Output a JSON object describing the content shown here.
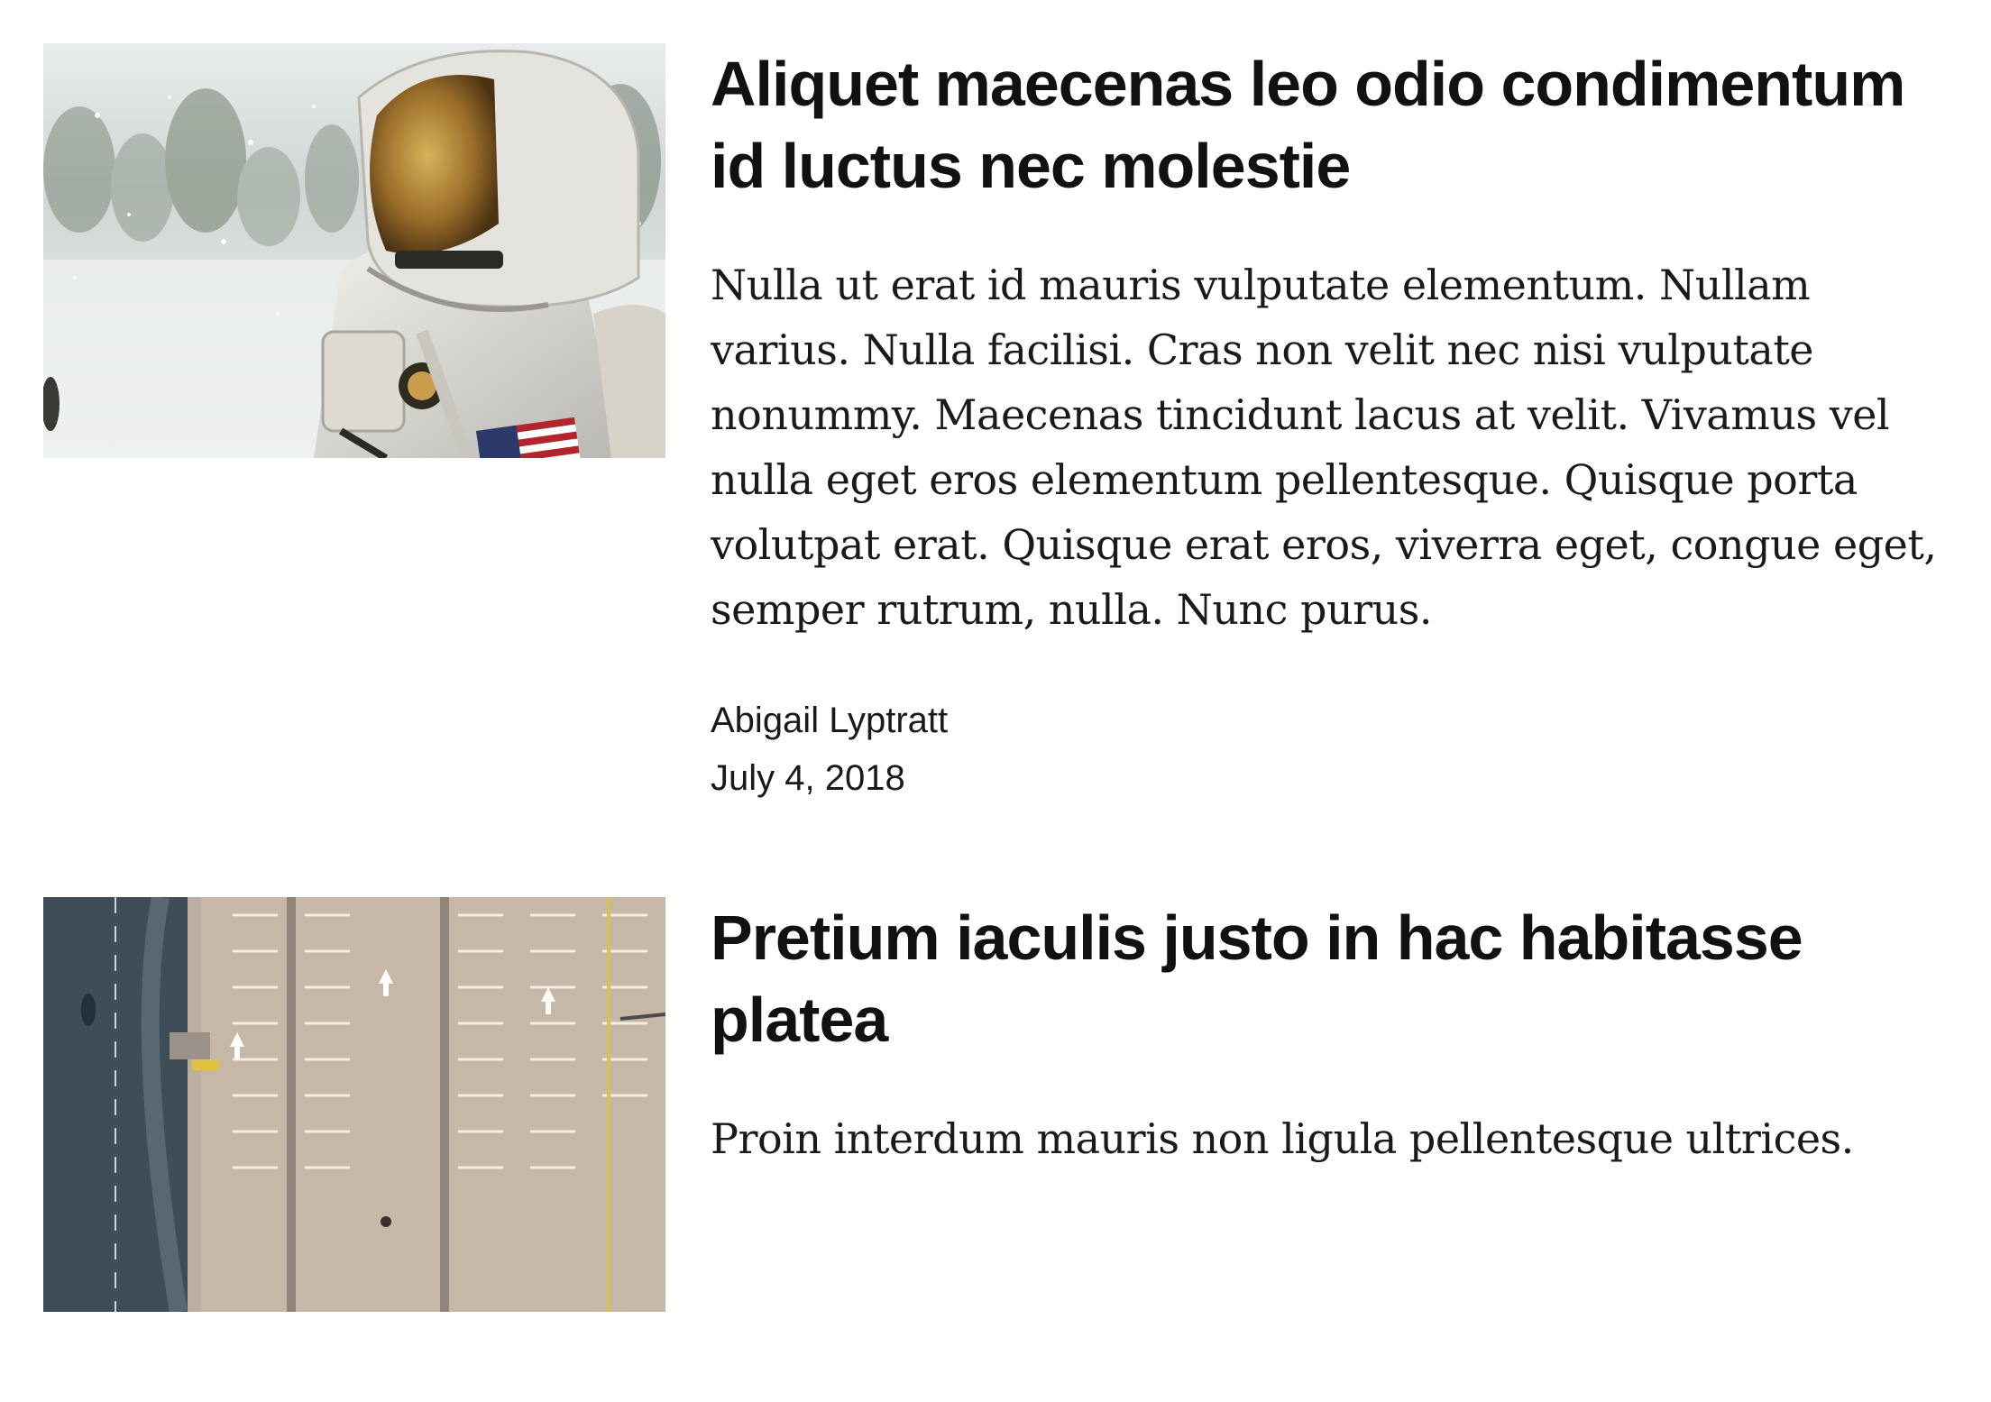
{
  "articles": [
    {
      "title": "Aliquet maecenas leo odio condimentum id luctus nec molestie",
      "summary": "Nulla ut erat id mauris vulputate elementum. Nullam varius. Nulla facilisi. Cras non velit nec nisi vulputate nonummy. Maecenas tincidunt lacus at velit. Vivamus vel nulla eget eros elementum pellentesque. Quisque porta volutpat erat. Quisque erat eros, viverra eget, congue eget, semper rutrum, nulla. Nunc purus.",
      "author": "Abigail Lyptratt",
      "date": "July 4, 2018",
      "image_icon": "astronaut-photo"
    },
    {
      "title": "Pretium iaculis justo in hac habitasse platea",
      "summary": "Proin interdum mauris non ligula pellentesque ultrices.",
      "image_icon": "parking-lot-aerial-photo"
    }
  ]
}
